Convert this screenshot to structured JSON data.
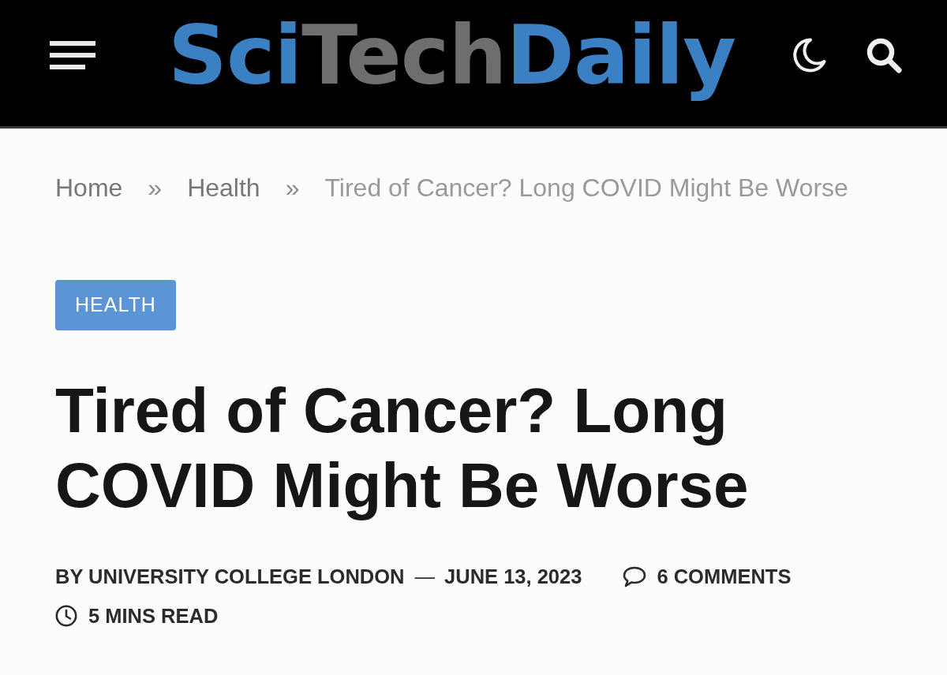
{
  "header": {
    "logo": [
      {
        "text": "Sci",
        "kind": "accent"
      },
      {
        "text": "Tech",
        "kind": "plain"
      },
      {
        "text": "Daily",
        "kind": "accent"
      }
    ]
  },
  "breadcrumb": [
    {
      "kind": "link",
      "text": "Home"
    },
    {
      "kind": "separator",
      "text": "»"
    },
    {
      "kind": "link",
      "text": "Health"
    },
    {
      "kind": "separator",
      "text": "»"
    },
    {
      "kind": "current",
      "text": "Tired of Cancer? Long COVID Might Be Worse"
    }
  ],
  "article": {
    "category": "HEALTH",
    "title": "Tired of Cancer? Long COVID Might Be Worse",
    "meta": {
      "author": "BY UNIVERSITY COLLEGE LONDON",
      "separator": "—",
      "date": "JUNE 13, 2023",
      "comments": "6 COMMENTS",
      "read_time": "5 MINS READ"
    }
  }
}
